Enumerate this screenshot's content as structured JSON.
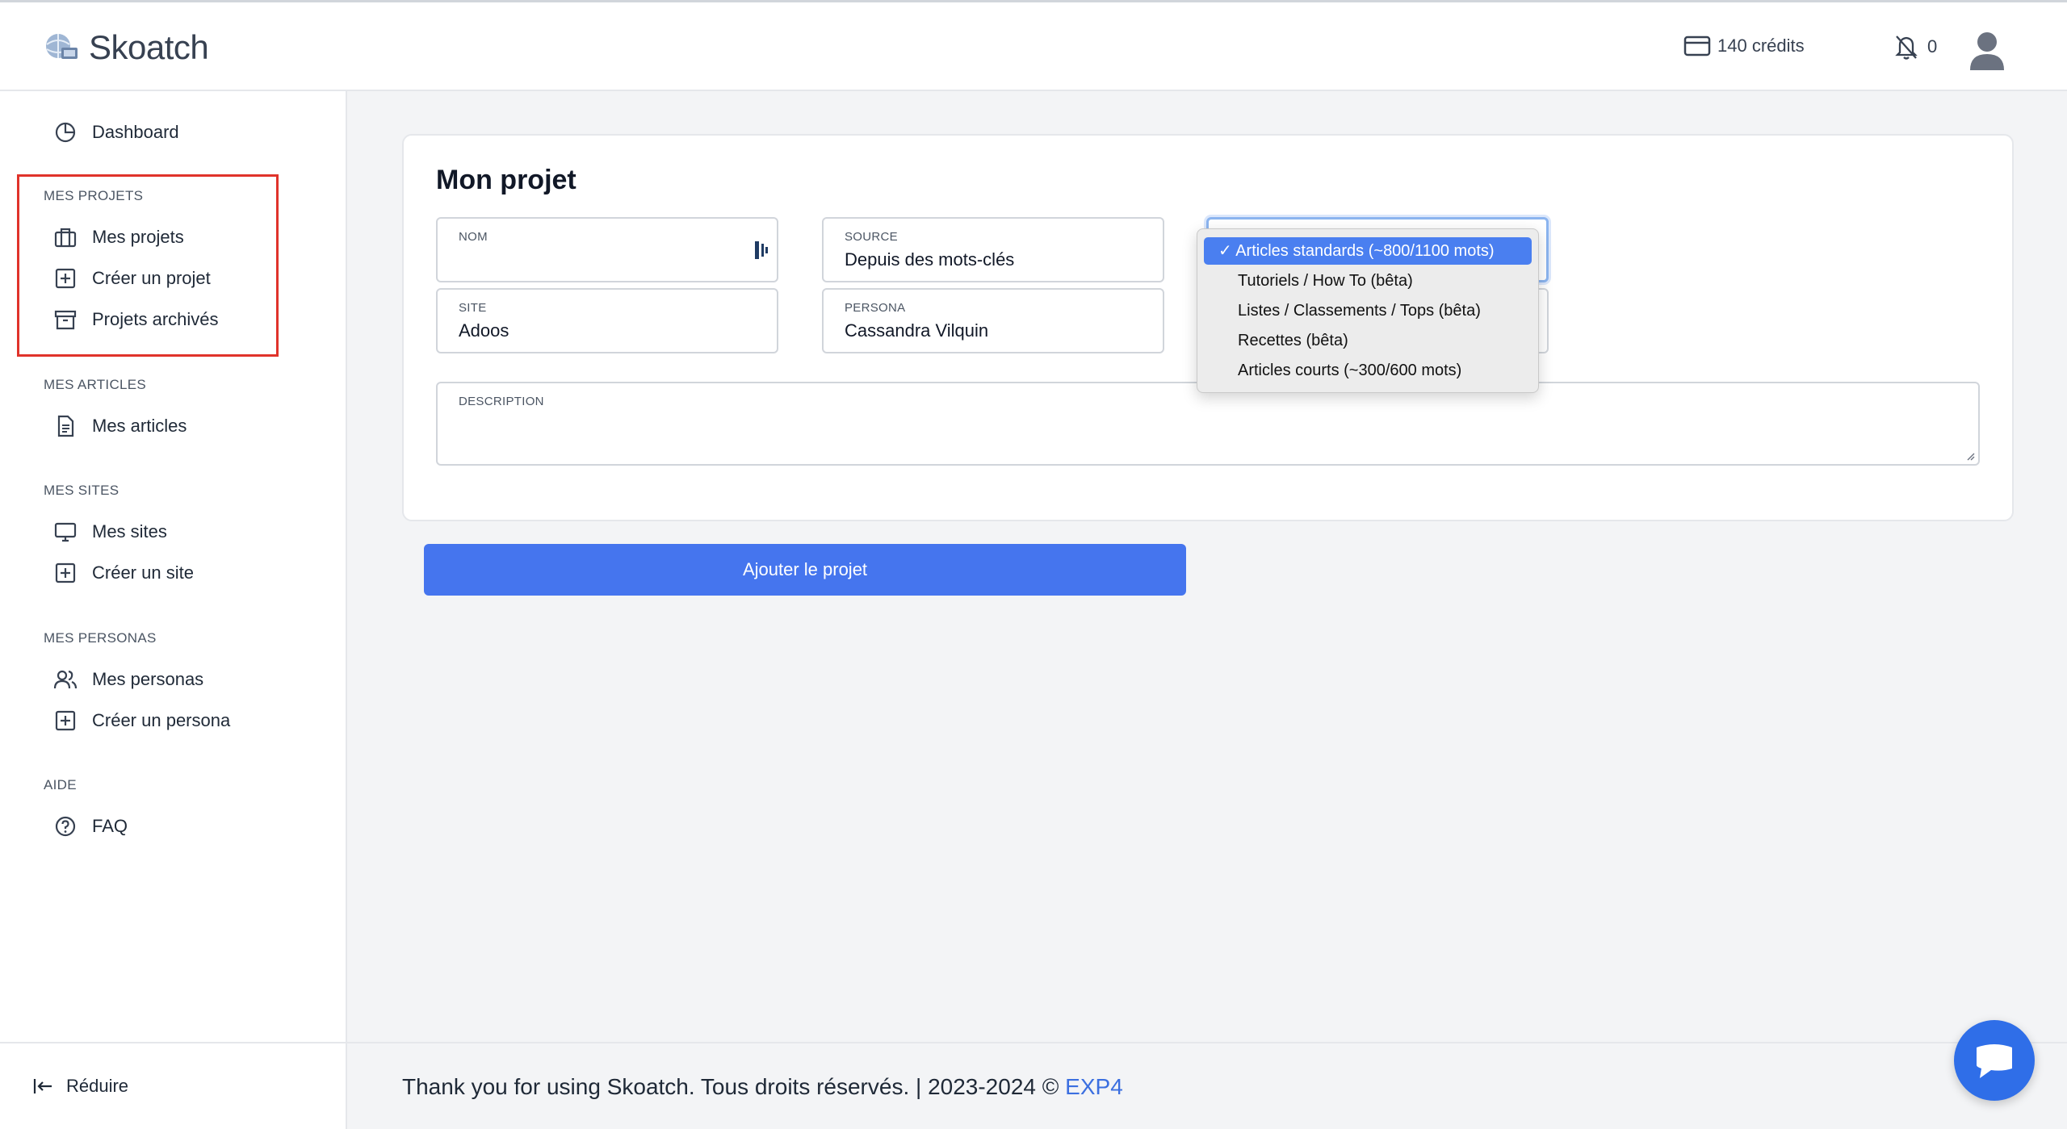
{
  "brand": {
    "name": "Skoatch"
  },
  "header": {
    "credits_label": "140 crédits",
    "notifications_count": "0"
  },
  "sidebar": {
    "dashboard": "Dashboard",
    "sections": {
      "projects": "MES PROJETS",
      "articles": "MES ARTICLES",
      "sites": "MES SITES",
      "personas": "MES PERSONAS",
      "help": "AIDE"
    },
    "items": {
      "my_projects": "Mes projets",
      "create_project": "Créer un projet",
      "archived_projects": "Projets archivés",
      "my_articles": "Mes articles",
      "my_sites": "Mes sites",
      "create_site": "Créer un site",
      "my_personas": "Mes personas",
      "create_persona": "Créer un persona",
      "faq": "FAQ"
    },
    "collapse_label": "Réduire"
  },
  "form": {
    "title": "Mon projet",
    "nom": {
      "label": "NOM",
      "value": ""
    },
    "source": {
      "label": "SOURCE",
      "value": "Depuis des mots-clés"
    },
    "site": {
      "label": "SITE",
      "value": "Adoos"
    },
    "persona": {
      "label": "PERSONA",
      "value": "Cassandra Vilquin"
    },
    "description": {
      "label": "DESCRIPTION",
      "value": ""
    },
    "type_options": [
      "✓ Articles standards (~800/1100 mots)",
      "Tutoriels / How To (bêta)",
      "Listes / Classements / Tops (bêta)",
      "Recettes (bêta)",
      "Articles courts (~300/600 mots)"
    ],
    "submit_label": "Ajouter le projet"
  },
  "footer": {
    "text": "Thank you for using Skoatch. Tous droits réservés. | 2023-2024 © ",
    "link": "EXP4"
  },
  "colors": {
    "accent": "#4575ee",
    "highlight_box": "#e0332b",
    "link": "#3b6fe0"
  }
}
